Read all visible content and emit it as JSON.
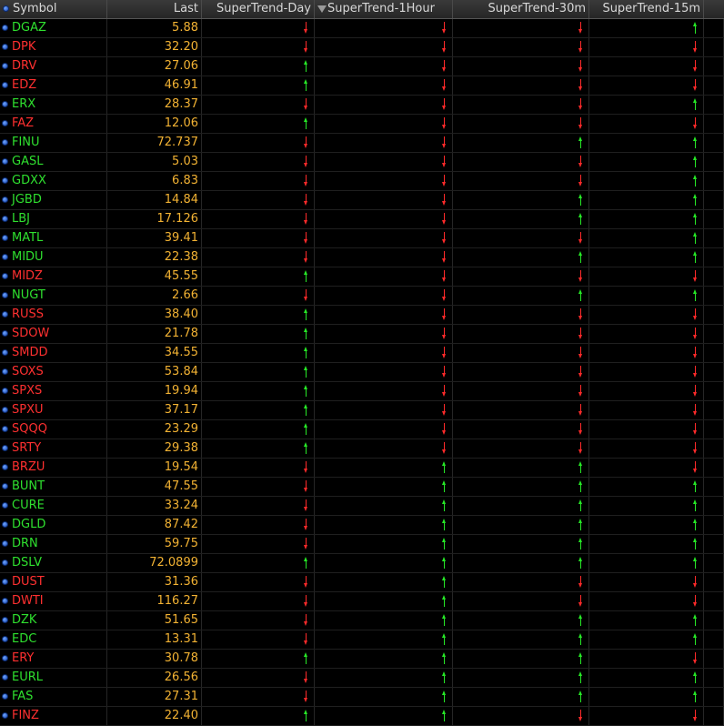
{
  "header": {
    "symbol": "Symbol",
    "last": "Last",
    "day": "SuperTrend-Day",
    "hour": "SuperTrend-1Hour",
    "m30": "SuperTrend-30m",
    "m15": "SuperTrend-15m",
    "sort_icon": "sort-desc-triangle-icon"
  },
  "colors": {
    "up": "#27e827",
    "down": "#ff2a2a",
    "last": "#f2b233",
    "background": "#000000"
  },
  "rows": [
    {
      "symbol": "DGAZ",
      "last": "5.88",
      "day": "down",
      "h1": "down",
      "m30": "down",
      "m15": "up"
    },
    {
      "symbol": "DPK",
      "last": "32.20",
      "day": "down",
      "h1": "down",
      "m30": "down",
      "m15": "down"
    },
    {
      "symbol": "DRV",
      "last": "27.06",
      "day": "up",
      "h1": "down",
      "m30": "down",
      "m15": "down"
    },
    {
      "symbol": "EDZ",
      "last": "46.91",
      "day": "up",
      "h1": "down",
      "m30": "down",
      "m15": "down"
    },
    {
      "symbol": "ERX",
      "last": "28.37",
      "day": "down",
      "h1": "down",
      "m30": "down",
      "m15": "up"
    },
    {
      "symbol": "FAZ",
      "last": "12.06",
      "day": "up",
      "h1": "down",
      "m30": "down",
      "m15": "down"
    },
    {
      "symbol": "FINU",
      "last": "72.737",
      "day": "down",
      "h1": "down",
      "m30": "up",
      "m15": "up"
    },
    {
      "symbol": "GASL",
      "last": "5.03",
      "day": "down",
      "h1": "down",
      "m30": "down",
      "m15": "up"
    },
    {
      "symbol": "GDXX",
      "last": "6.83",
      "day": "down",
      "h1": "down",
      "m30": "down",
      "m15": "up"
    },
    {
      "symbol": "JGBD",
      "last": "14.84",
      "day": "down",
      "h1": "down",
      "m30": "up",
      "m15": "up"
    },
    {
      "symbol": "LBJ",
      "last": "17.126",
      "day": "down",
      "h1": "down",
      "m30": "up",
      "m15": "up"
    },
    {
      "symbol": "MATL",
      "last": "39.41",
      "day": "down",
      "h1": "down",
      "m30": "down",
      "m15": "up"
    },
    {
      "symbol": "MIDU",
      "last": "22.38",
      "day": "down",
      "h1": "down",
      "m30": "up",
      "m15": "up"
    },
    {
      "symbol": "MIDZ",
      "last": "45.55",
      "day": "up",
      "h1": "down",
      "m30": "down",
      "m15": "down"
    },
    {
      "symbol": "NUGT",
      "last": "2.66",
      "day": "down",
      "h1": "down",
      "m30": "up",
      "m15": "up"
    },
    {
      "symbol": "RUSS",
      "last": "38.40",
      "day": "up",
      "h1": "down",
      "m30": "down",
      "m15": "down"
    },
    {
      "symbol": "SDOW",
      "last": "21.78",
      "day": "up",
      "h1": "down",
      "m30": "down",
      "m15": "down"
    },
    {
      "symbol": "SMDD",
      "last": "34.55",
      "day": "up",
      "h1": "down",
      "m30": "down",
      "m15": "down"
    },
    {
      "symbol": "SOXS",
      "last": "53.84",
      "day": "up",
      "h1": "down",
      "m30": "down",
      "m15": "down"
    },
    {
      "symbol": "SPXS",
      "last": "19.94",
      "day": "up",
      "h1": "down",
      "m30": "down",
      "m15": "down"
    },
    {
      "symbol": "SPXU",
      "last": "37.17",
      "day": "up",
      "h1": "down",
      "m30": "down",
      "m15": "down"
    },
    {
      "symbol": "SQQQ",
      "last": "23.29",
      "day": "up",
      "h1": "down",
      "m30": "down",
      "m15": "down"
    },
    {
      "symbol": "SRTY",
      "last": "29.38",
      "day": "up",
      "h1": "down",
      "m30": "down",
      "m15": "down"
    },
    {
      "symbol": "BRZU",
      "last": "19.54",
      "day": "down",
      "h1": "up",
      "m30": "up",
      "m15": "down"
    },
    {
      "symbol": "BUNT",
      "last": "47.55",
      "day": "down",
      "h1": "up",
      "m30": "up",
      "m15": "up"
    },
    {
      "symbol": "CURE",
      "last": "33.24",
      "day": "down",
      "h1": "up",
      "m30": "up",
      "m15": "up"
    },
    {
      "symbol": "DGLD",
      "last": "87.42",
      "day": "down",
      "h1": "up",
      "m30": "up",
      "m15": "up"
    },
    {
      "symbol": "DRN",
      "last": "59.75",
      "day": "down",
      "h1": "up",
      "m30": "up",
      "m15": "up"
    },
    {
      "symbol": "DSLV",
      "last": "72.0899",
      "day": "up",
      "h1": "up",
      "m30": "up",
      "m15": "up"
    },
    {
      "symbol": "DUST",
      "last": "31.36",
      "day": "down",
      "h1": "up",
      "m30": "down",
      "m15": "down"
    },
    {
      "symbol": "DWTI",
      "last": "116.27",
      "day": "down",
      "h1": "up",
      "m30": "down",
      "m15": "down"
    },
    {
      "symbol": "DZK",
      "last": "51.65",
      "day": "down",
      "h1": "up",
      "m30": "up",
      "m15": "up"
    },
    {
      "symbol": "EDC",
      "last": "13.31",
      "day": "down",
      "h1": "up",
      "m30": "up",
      "m15": "up"
    },
    {
      "symbol": "ERY",
      "last": "30.78",
      "day": "up",
      "h1": "up",
      "m30": "up",
      "m15": "down"
    },
    {
      "symbol": "EURL",
      "last": "26.56",
      "day": "down",
      "h1": "up",
      "m30": "up",
      "m15": "up"
    },
    {
      "symbol": "FAS",
      "last": "27.31",
      "day": "down",
      "h1": "up",
      "m30": "up",
      "m15": "up"
    },
    {
      "symbol": "FINZ",
      "last": "22.40",
      "day": "up",
      "h1": "up",
      "m30": "down",
      "m15": "down"
    }
  ]
}
